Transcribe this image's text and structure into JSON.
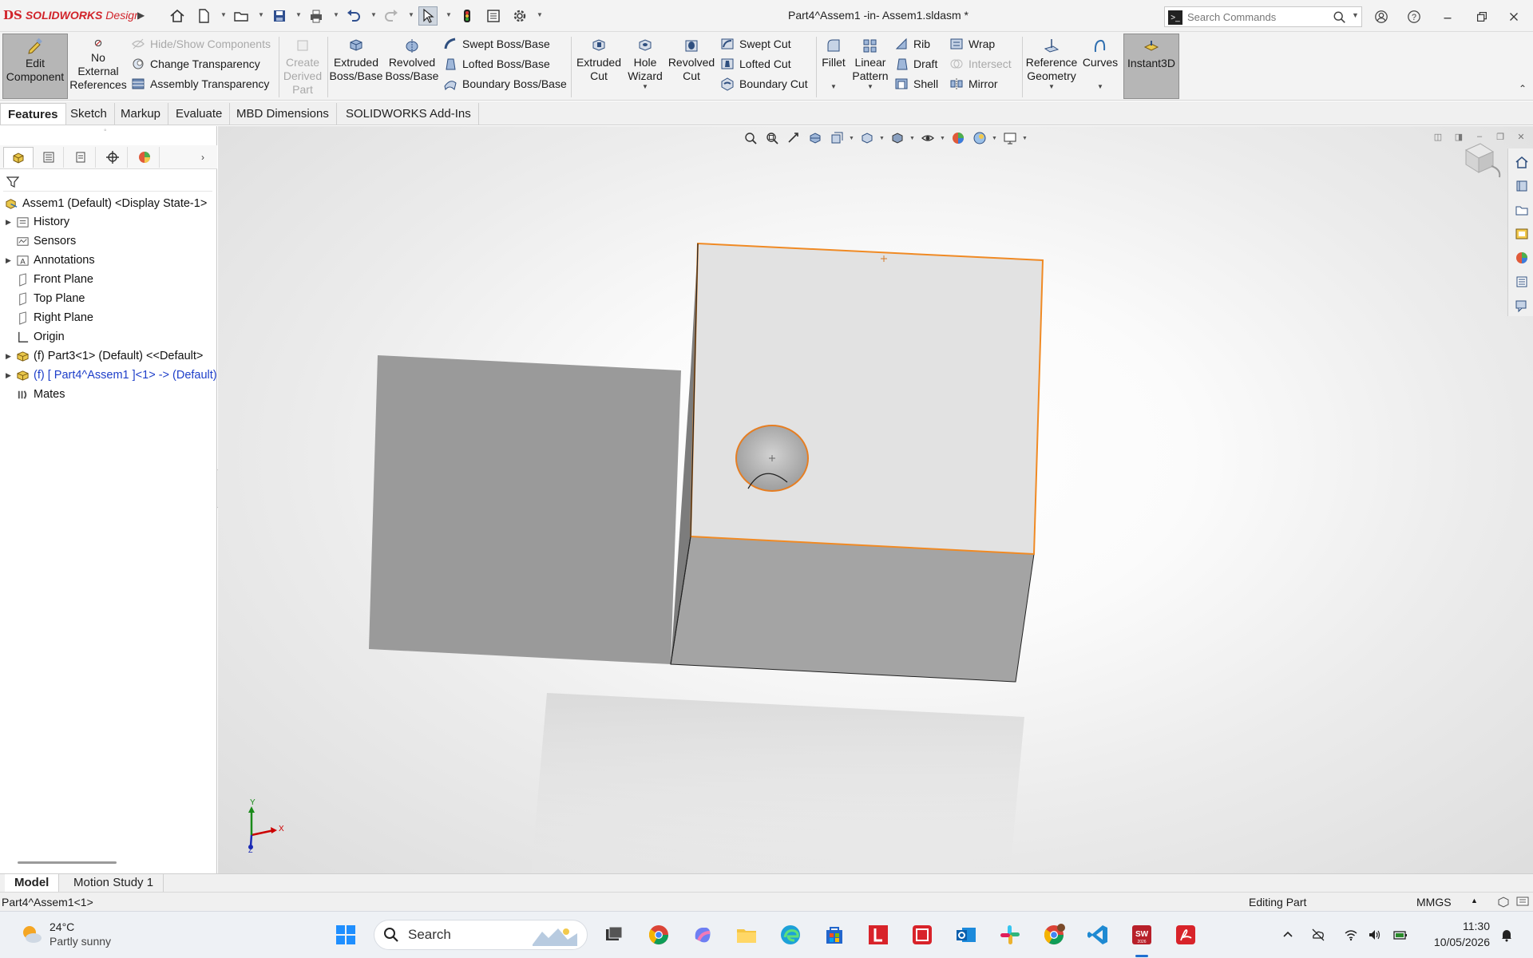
{
  "app": {
    "brand_ds": "DS",
    "brand_name": "SOLIDWORKS",
    "brand_design": "Design",
    "document_title": "Part4^Assem1 -in- Assem1.sldasm *",
    "search_placeholder": "Search Commands",
    "accent_color": "#d1232a"
  },
  "ribbon": {
    "edit_component": [
      "Edit",
      "Component"
    ],
    "no_external_references": [
      "No",
      "External",
      "References"
    ],
    "hide_show_components": "Hide/Show Components",
    "change_transparency": "Change Transparency",
    "assembly_transparency": "Assembly Transparency",
    "create_derived_part": [
      "Create",
      "Derived",
      "Part"
    ],
    "extruded_boss": [
      "Extruded",
      "Boss/Base"
    ],
    "revolved_boss": [
      "Revolved",
      "Boss/Base"
    ],
    "swept_boss": "Swept Boss/Base",
    "lofted_boss": "Lofted Boss/Base",
    "boundary_boss": "Boundary Boss/Base",
    "extruded_cut": [
      "Extruded",
      "Cut"
    ],
    "hole_wizard": [
      "Hole",
      "Wizard"
    ],
    "revolved_cut": [
      "Revolved",
      "Cut"
    ],
    "swept_cut": "Swept Cut",
    "lofted_cut": "Lofted Cut",
    "boundary_cut": "Boundary Cut",
    "fillet": "Fillet",
    "linear_pattern": [
      "Linear",
      "Pattern"
    ],
    "rib": "Rib",
    "draft": "Draft",
    "shell": "Shell",
    "wrap": "Wrap",
    "intersect": "Intersect",
    "mirror": "Mirror",
    "reference_geometry": [
      "Reference",
      "Geometry"
    ],
    "curves": "Curves",
    "instant3d": "Instant3D"
  },
  "tabs": [
    "Features",
    "Sketch",
    "Markup",
    "Evaluate",
    "MBD Dimensions",
    "SOLIDWORKS Add-Ins"
  ],
  "feature_tree": {
    "root": "Assem1 (Default) <Display State-1>",
    "items": [
      {
        "label": "History",
        "expandable": true
      },
      {
        "label": "Sensors",
        "expandable": false
      },
      {
        "label": "Annotations",
        "expandable": true
      },
      {
        "label": "Front Plane",
        "expandable": false
      },
      {
        "label": "Top Plane",
        "expandable": false
      },
      {
        "label": "Right Plane",
        "expandable": false
      },
      {
        "label": "Origin",
        "expandable": false
      },
      {
        "label": "(f) Part3<1> (Default) <<Default>",
        "expandable": true
      },
      {
        "label": "(f) [ Part4^Assem1 ]<1> -> (Default)",
        "expandable": true
      },
      {
        "label": "Mates",
        "expandable": false
      }
    ]
  },
  "viewport": {
    "triad_x": "X",
    "triad_y": "Y",
    "triad_z": "Z",
    "selection_color": "#f08a24"
  },
  "bottom_tabs": [
    "Model",
    "Motion Study 1"
  ],
  "status": {
    "selected": "Part4^Assem1<1>",
    "mode": "Editing Part",
    "units": "MMGS"
  },
  "taskbar": {
    "temperature": "24°C",
    "condition": "Partly sunny",
    "search_label": "Search",
    "time": "11:30",
    "date": "10/05/2026"
  }
}
